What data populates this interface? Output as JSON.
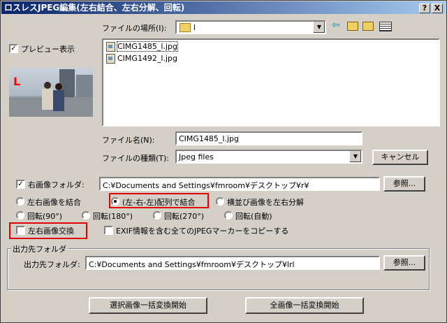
{
  "window": {
    "title": "ロスレスJPEG編集(左右結合、左右分解、回転)",
    "help_label": "?",
    "close_label": "X"
  },
  "location": {
    "label": "ファイルの場所(I):",
    "value": "l"
  },
  "toolbar": {
    "back_icon": "back-arrow-icon",
    "up_icon": "up-folder-icon",
    "newfolder_icon": "new-folder-icon",
    "view_icon": "view-menu-icon"
  },
  "preview": {
    "checkbox_label": "プレビュー表示",
    "checked": true,
    "overlay_letter": "L"
  },
  "files": [
    {
      "name": "CIMG1485_l.jpg",
      "selected": true
    },
    {
      "name": "CIMG1492_l.jpg",
      "selected": false
    }
  ],
  "filename": {
    "label": "ファイル名(N):",
    "value": "CIMG1485_l.jpg"
  },
  "filetype": {
    "label": "ファイルの種類(T):",
    "value": "Jpeg files"
  },
  "cancel_label": "キャンセル",
  "right_folder": {
    "checkbox_label": "右画像フォルダ:",
    "checked": true,
    "value": "C:¥Documents and Settings¥fmroom¥デスクトップ¥r¥",
    "browse_label": "参照..."
  },
  "mode_options": [
    {
      "label": "左右画像を結合",
      "selected": false
    },
    {
      "label": "(左-右-左)配列で結合",
      "selected": true
    },
    {
      "label": "横並び画像を左右分解",
      "selected": false
    }
  ],
  "rotate_options": [
    {
      "label": "回転(90°)",
      "selected": false
    },
    {
      "label": "回転(180°)",
      "selected": false
    },
    {
      "label": "回転(270°)",
      "selected": false
    },
    {
      "label": "回転(自動)",
      "selected": false
    }
  ],
  "swap_checkbox": {
    "label": "左右画像交換",
    "checked": false
  },
  "exif_checkbox": {
    "label": "EXIF情報を含む全てのJPEGマーカーをコピーする",
    "checked": false
  },
  "output_group": {
    "title": "出力先フォルダ",
    "label": "出力先フォルダ:",
    "value": "C:¥Documents and Settings¥fmroom¥デスクトップ¥lrl",
    "browse_label": "参照..."
  },
  "buttons": {
    "convert_selected": "選択画像一括変換開始",
    "convert_all": "全画像一括変換開始"
  }
}
